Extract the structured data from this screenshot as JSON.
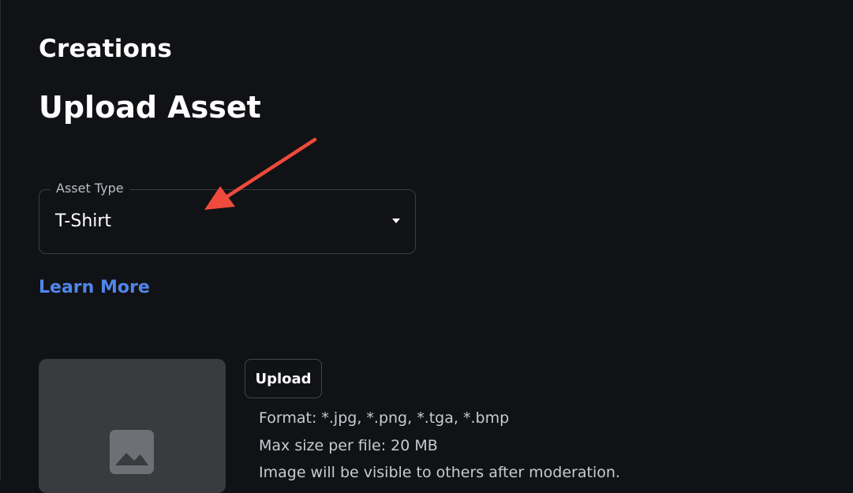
{
  "header": {
    "section_title": "Creations",
    "page_title": "Upload Asset"
  },
  "asset_type_select": {
    "label": "Asset Type",
    "selected_value": "T-Shirt"
  },
  "learn_more": {
    "label": "Learn More",
    "color": "#4f86ea"
  },
  "upload": {
    "button_label": "Upload",
    "info": {
      "format": "Format: *.jpg, *.png, *.tga, *.bmp",
      "max_size": "Max size per file: 20 MB",
      "visibility": "Image will be visible to others after moderation."
    }
  },
  "annotation": {
    "arrow_color": "#ef4a3c"
  }
}
